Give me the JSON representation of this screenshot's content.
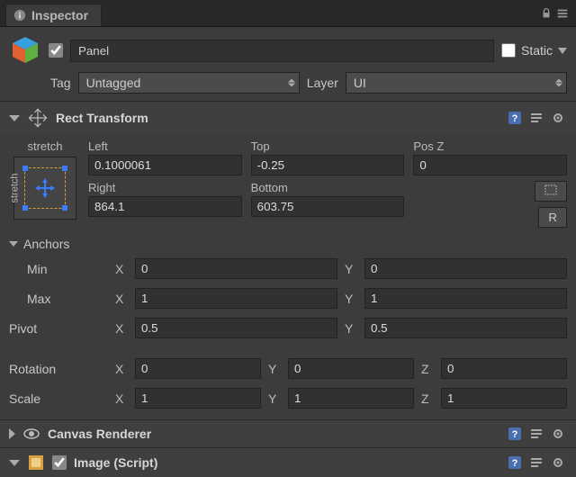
{
  "tab": {
    "title": "Inspector"
  },
  "header": {
    "active": true,
    "name": "Panel",
    "static_label": "Static",
    "static_checked": false,
    "tag_label": "Tag",
    "tag_value": "Untagged",
    "layer_label": "Layer",
    "layer_value": "UI"
  },
  "rect": {
    "title": "Rect Transform",
    "stretch_h": "stretch",
    "stretch_v": "stretch",
    "left_label": "Left",
    "left": "0.1000061",
    "top_label": "Top",
    "top": "-0.25",
    "posz_label": "Pos Z",
    "posz": "0",
    "right_label": "Right",
    "right": "864.1",
    "bottom_label": "Bottom",
    "bottom": "603.75",
    "blueprint_btn": "⦾",
    "raw_btn": "R",
    "anchors": {
      "label": "Anchors",
      "min_label": "Min",
      "min_x": "0",
      "min_y": "0",
      "max_label": "Max",
      "max_x": "1",
      "max_y": "1"
    },
    "pivot": {
      "label": "Pivot",
      "x": "0.5",
      "y": "0.5"
    },
    "rotation": {
      "label": "Rotation",
      "x": "0",
      "y": "0",
      "z": "0"
    },
    "scale": {
      "label": "Scale",
      "x": "1",
      "y": "1",
      "z": "1"
    }
  },
  "comp2": {
    "title": "Canvas Renderer"
  },
  "comp3": {
    "title": "Image (Script)",
    "enabled": true
  },
  "axis": {
    "x": "X",
    "y": "Y",
    "z": "Z"
  }
}
